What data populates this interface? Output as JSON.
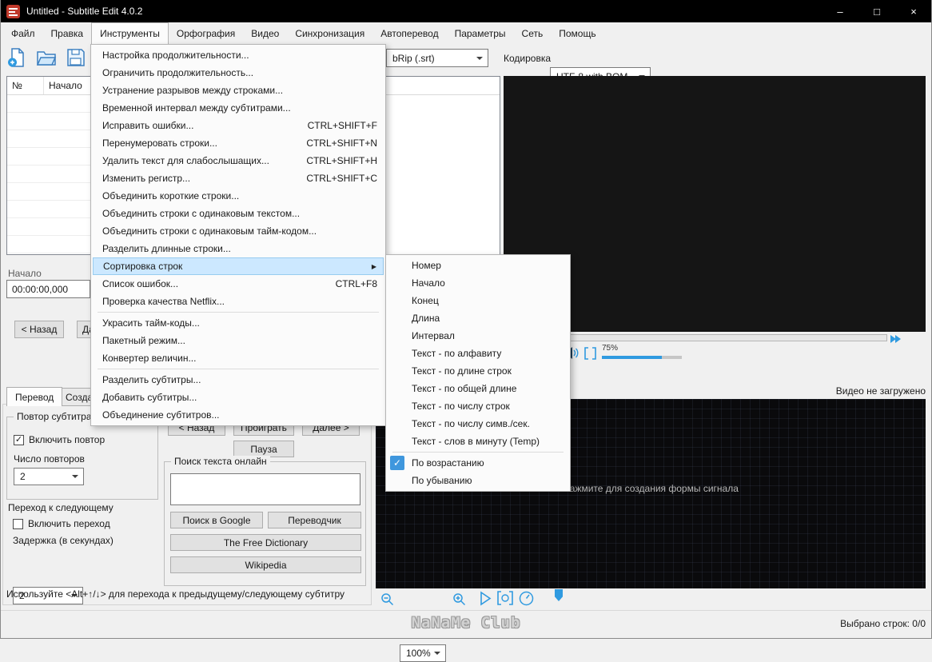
{
  "window": {
    "title": "Untitled - Subtitle Edit 4.0.2",
    "minimize": "–",
    "maximize": "□",
    "close": "×",
    "icons": [
      "app-icon",
      "minimize-icon",
      "maximize-icon",
      "close-icon"
    ]
  },
  "menubar": {
    "items": [
      {
        "label": "Файл"
      },
      {
        "label": "Правка"
      },
      {
        "label": "Инструменты",
        "open": true
      },
      {
        "label": "Орфография"
      },
      {
        "label": "Видео"
      },
      {
        "label": "Синхронизация"
      },
      {
        "label": "Автоперевод"
      },
      {
        "label": "Параметры"
      },
      {
        "label": "Сеть"
      },
      {
        "label": "Помощь"
      }
    ]
  },
  "tools_menu": {
    "items": [
      {
        "label": "Настройка продолжительности..."
      },
      {
        "label": "Ограничить продолжительность..."
      },
      {
        "label": "Устранение разрывов между строками..."
      },
      {
        "label": "Временной интервал между субтитрами..."
      },
      {
        "label": "Исправить ошибки...",
        "shortcut": "CTRL+SHIFT+F"
      },
      {
        "label": "Перенумеровать строки...",
        "shortcut": "CTRL+SHIFT+N"
      },
      {
        "label": "Удалить текст для слабослышащих...",
        "shortcut": "CTRL+SHIFT+H"
      },
      {
        "label": "Изменить регистр...",
        "shortcut": "CTRL+SHIFT+C"
      },
      {
        "label": "Объединить короткие строки..."
      },
      {
        "label": "Объединить строки с одинаковым текстом..."
      },
      {
        "label": "Объединить строки с одинаковым тайм-кодом..."
      },
      {
        "label": "Разделить длинные строки..."
      },
      {
        "label": "Сортировка строк",
        "submenu": true,
        "highlighted": true
      },
      {
        "label": "Список ошибок...",
        "shortcut": "CTRL+F8"
      },
      {
        "label": "Проверка качества Netflix..."
      },
      {
        "separator": true
      },
      {
        "label": "Украсить тайм-коды..."
      },
      {
        "label": "Пакетный режим..."
      },
      {
        "label": "Конвертер величин..."
      },
      {
        "separator": true
      },
      {
        "label": "Разделить субтитры..."
      },
      {
        "label": "Добавить субтитры..."
      },
      {
        "label": "Объединение субтитров..."
      }
    ]
  },
  "sort_submenu": {
    "items": [
      {
        "label": "Номер"
      },
      {
        "label": "Начало"
      },
      {
        "label": "Конец"
      },
      {
        "label": "Длина"
      },
      {
        "label": "Интервал"
      },
      {
        "label": "Текст - по алфавиту"
      },
      {
        "label": "Текст - по длине строк"
      },
      {
        "label": "Текст - по общей длине"
      },
      {
        "label": "Текст - по числу строк"
      },
      {
        "label": "Текст - по числу симв./сек."
      },
      {
        "label": "Текст - слов в минуту (Temp)"
      },
      {
        "separator": true
      },
      {
        "label": "По возрастанию",
        "checked": true
      },
      {
        "label": "По убыванию"
      }
    ],
    "icons": [
      "checkmark-icon",
      "submenu-arrow-icon"
    ]
  },
  "toolbar": {
    "format_value": "bRip (.srt)",
    "encoding_label": "Кодировка",
    "encoding_value": "UTF-8 with BOM",
    "icons": [
      "new-file-icon",
      "open-file-icon",
      "save-icon"
    ]
  },
  "subtitle_list": {
    "col_number": "№",
    "col_start": "Начало"
  },
  "edit_panel": {
    "start_label": "Начало",
    "start_value": "00:00:00,000",
    "back_button": "< Назад",
    "next_button": "Далее >"
  },
  "tabs": {
    "translate": "Перевод",
    "create": "Создание"
  },
  "repeat_group": {
    "title": "Повтор субтитра",
    "enable_label": "Включить повтор",
    "enable_checked": "✓",
    "count_label": "Число повторов",
    "count_value": "2"
  },
  "advance_group": {
    "title": "Переход к следующему",
    "enable_label": "Включить переход",
    "delay_label": "Задержка (в секундах)",
    "delay_value": "2"
  },
  "hint": "Используйте <Alt+↑/↓> для перехода к предыдущему/следующему субтитру",
  "playback": {
    "back": "< Назад",
    "play": "Проиграть",
    "next": "Далее >",
    "pause": "Пауза"
  },
  "search_group": {
    "title": "Поиск текста онлайн",
    "input_value": "",
    "google": "Поиск в Google",
    "translator": "Переводчик",
    "freedict": "The Free Dictionary",
    "wikipedia": "Wikipedia"
  },
  "video": {
    "not_loaded": "Видео не загружено",
    "volume": "75%",
    "icons": [
      "speaker-icon",
      "brackets-icon",
      "fast-forward-icon"
    ]
  },
  "waveform": {
    "prompt": "Нажмите для создания формы сигнала",
    "zoom_value": "100%",
    "icons": [
      "zoom-out-icon",
      "zoom-in-icon",
      "play-icon",
      "play-selection-icon",
      "speed-gauge-icon",
      "position-marker-icon"
    ]
  },
  "statusbar": {
    "selected": "Выбрано строк: 0/0",
    "watermark": "NaNaMe Club"
  }
}
